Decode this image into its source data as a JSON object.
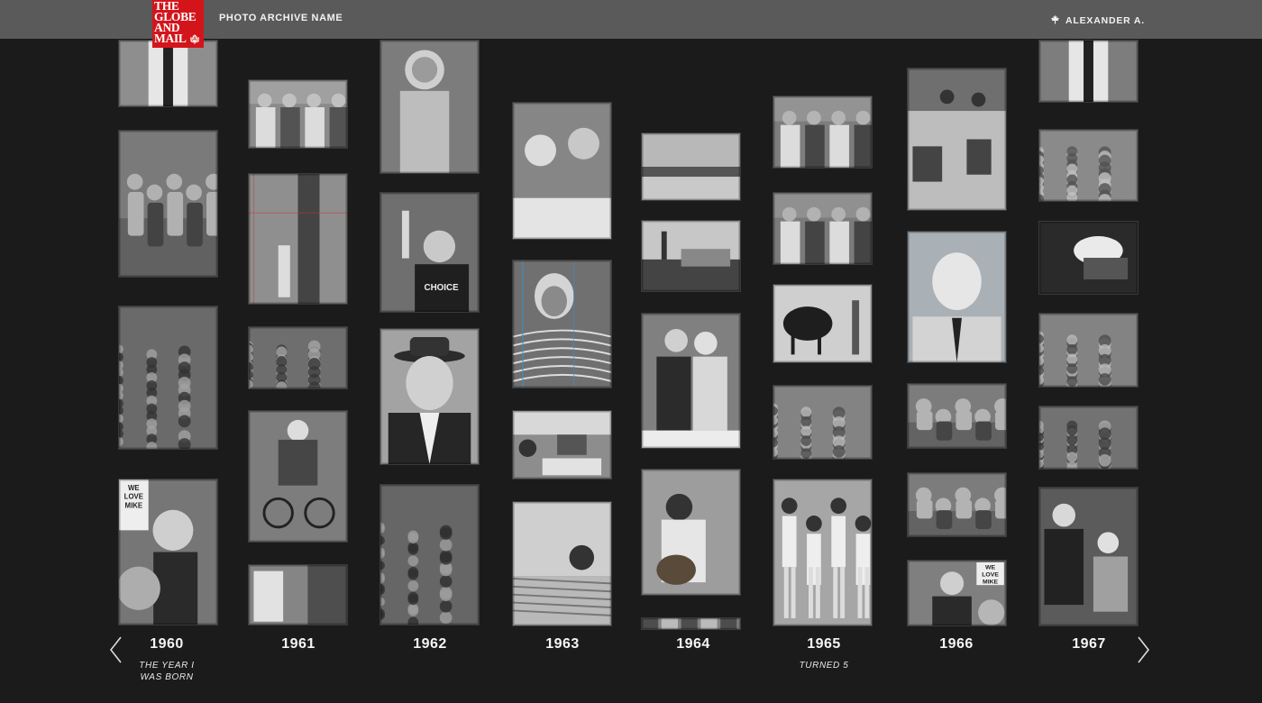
{
  "header": {
    "logo_lines": [
      "THE",
      "GLOBE",
      "AND",
      "MAIL"
    ],
    "archive_title": "PHOTO ARCHIVE NAME",
    "user_name": "ALEXANDER A.",
    "user_icon": "maple-leaf-icon",
    "logo_icon": "maple-leaf-icon"
  },
  "nav": {
    "prev_icon": "chevron-left-icon",
    "next_icon": "chevron-right-icon"
  },
  "timeline": [
    {
      "year": "1960",
      "caption": [
        "THE YEAR I",
        "WAS BORN"
      ]
    },
    {
      "year": "1961",
      "caption": []
    },
    {
      "year": "1962",
      "caption": []
    },
    {
      "year": "1963",
      "caption": []
    },
    {
      "year": "1964",
      "caption": []
    },
    {
      "year": "1965",
      "caption": [
        "TURNED 5"
      ]
    },
    {
      "year": "1966",
      "caption": []
    },
    {
      "year": "1967",
      "caption": []
    }
  ],
  "photo_signs": {
    "we_love_mike": [
      "WE",
      "LOVE",
      "MIKE"
    ],
    "choice": "CHOICE"
  },
  "colors": {
    "background": "#1b1b1c",
    "header": "#5a5a5b",
    "logo_red": "#d3151b"
  }
}
